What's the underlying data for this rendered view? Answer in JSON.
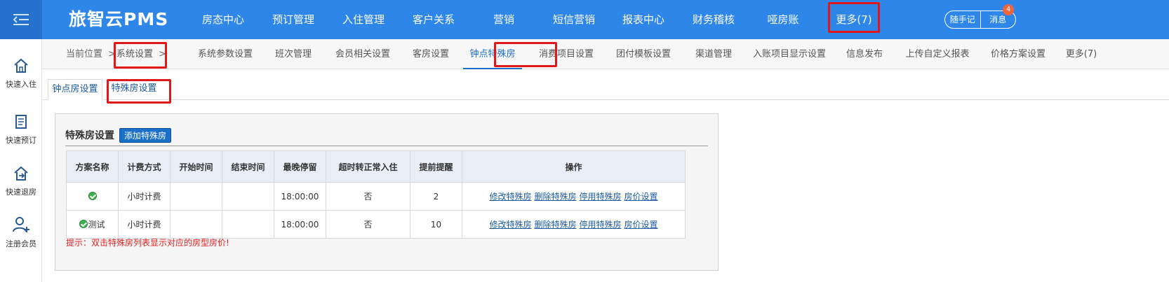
{
  "app": {
    "brand": "旅智云PMS"
  },
  "top_nav": [
    {
      "label": "房态中心"
    },
    {
      "label": "预订管理"
    },
    {
      "label": "入住管理"
    },
    {
      "label": "客户关系"
    },
    {
      "label": "营销"
    },
    {
      "label": "短信营销"
    },
    {
      "label": "报表中心"
    },
    {
      "label": "财务稽核"
    },
    {
      "label": "哑房账"
    },
    {
      "label": "更多(7)"
    }
  ],
  "top_right": {
    "notes": "随手记",
    "messages": "消息",
    "message_badge": "4"
  },
  "sidebar": [
    {
      "label": "快速入住",
      "icon": "home-icon"
    },
    {
      "label": "快速预订",
      "icon": "document-icon"
    },
    {
      "label": "快速退房",
      "icon": "checkout-icon"
    },
    {
      "label": "注册会员",
      "icon": "add-user-icon"
    }
  ],
  "breadcrumb": {
    "prefix": "当前位置",
    "sep": ">",
    "current": "系统设置"
  },
  "sub_tabs": [
    {
      "label": "系统参数设置"
    },
    {
      "label": "班次管理"
    },
    {
      "label": "会员相关设置"
    },
    {
      "label": "客房设置"
    },
    {
      "label": "钟点特殊房",
      "active": true
    },
    {
      "label": "消费项目设置"
    },
    {
      "label": "团付模板设置"
    },
    {
      "label": "渠道管理"
    },
    {
      "label": "入账项目显示设置"
    },
    {
      "label": "信息发布"
    },
    {
      "label": "上传自定义报表"
    },
    {
      "label": "价格方案设置"
    },
    {
      "label": "更多(7)"
    }
  ],
  "inner_tabs": [
    {
      "label": "钟点房设置",
      "active": true
    },
    {
      "label": "特殊房设置"
    }
  ],
  "panel": {
    "title": "特殊房设置",
    "add_button": "添加特殊房",
    "columns": [
      "方案名称",
      "计费方式",
      "开始时间",
      "结束时间",
      "最晚停留",
      "超时转正常入住",
      "提前提醒",
      "操作"
    ],
    "rows": [
      {
        "name": "",
        "billing": "小时计费",
        "start": "",
        "end": "",
        "latest": "18:00:00",
        "overtime": "否",
        "remind": "2"
      },
      {
        "name": "测试",
        "billing": "小时计费",
        "start": "",
        "end": "",
        "latest": "18:00:00",
        "overtime": "否",
        "remind": "10"
      }
    ],
    "actions": [
      "修改特殊房",
      "删除特殊房",
      "停用特殊房",
      "房价设置"
    ],
    "hint": "提示：双击特殊房列表显示对应的房型房价!"
  },
  "colors": {
    "topbar": "#2e87e8",
    "accent": "#1a6fc8",
    "annotation": "#e01818",
    "hint": "#e02020"
  }
}
